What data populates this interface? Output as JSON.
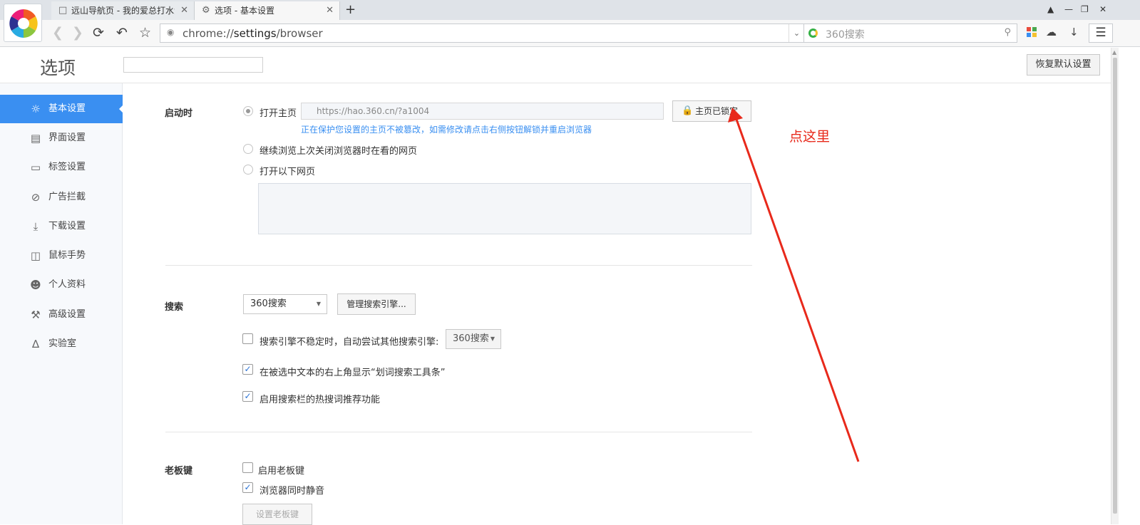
{
  "browser": {
    "tabs": [
      {
        "title": "远山导航页 - 我的爱总打水漂",
        "icon": "page-icon"
      },
      {
        "title": "选项 - 基本设置",
        "icon": "gear-icon"
      }
    ],
    "new_tab": "+",
    "address": {
      "scheme": "chrome://",
      "host": "settings",
      "path": "/browser"
    },
    "search_placeholder": "360搜索"
  },
  "page": {
    "title": "选项",
    "reset_button": "恢复默认设置"
  },
  "sidebar": {
    "items": [
      {
        "label": "基本设置",
        "icon": "gear-icon",
        "active": true
      },
      {
        "label": "界面设置",
        "icon": "window-icon"
      },
      {
        "label": "标签设置",
        "icon": "tab-icon"
      },
      {
        "label": "广告拦截",
        "icon": "block-icon"
      },
      {
        "label": "下载设置",
        "icon": "download-icon"
      },
      {
        "label": "鼠标手势",
        "icon": "mouse-icon"
      },
      {
        "label": "个人资料",
        "icon": "user-icon"
      },
      {
        "label": "高级设置",
        "icon": "wrench-icon"
      },
      {
        "label": "实验室",
        "icon": "flask-icon"
      }
    ]
  },
  "startup": {
    "section": "启动时",
    "open_home": "打开主页",
    "home_url": "https://hao.360.cn/?a1004",
    "lock_button": "主页已锁定",
    "notice": "正在保护您设置的主页不被篡改，如需修改请点击右侧按钮解锁并重启浏览器",
    "continue_last": "继续浏览上次关闭浏览器时在看的网页",
    "open_pages": "打开以下网页"
  },
  "search": {
    "section": "搜索",
    "engine": "360搜索",
    "manage_button": "管理搜索引擎...",
    "fallback_label": "搜索引擎不稳定时，自动尝试其他搜索引擎:",
    "fallback_engine": "360搜索",
    "fallback_checked": false,
    "toolbar_label": "在被选中文本的右上角显示“划词搜索工具条”",
    "toolbar_checked": true,
    "hotwords_label": "启用搜索栏的热搜词推荐功能",
    "hotwords_checked": true
  },
  "bosskey": {
    "section": "老板键",
    "enable_label": "启用老板键",
    "enable_checked": false,
    "mute_label": "浏览器同时静音",
    "mute_checked": true,
    "set_button": "设置老板键"
  },
  "annotation": {
    "text": "点这里",
    "color": "#e8291b"
  }
}
